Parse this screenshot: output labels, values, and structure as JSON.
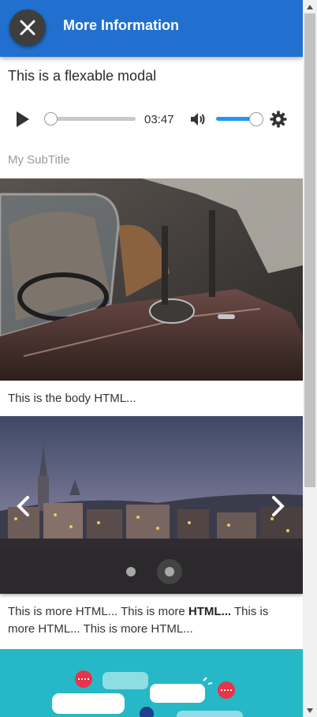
{
  "header": {
    "title": "More Information",
    "close_icon": "close-icon"
  },
  "modal": {
    "title": "This is a flexable modal",
    "subtitle": "My SubTitle",
    "body_text": "This is the body HTML...",
    "more_text": {
      "part1": "This is more HTML... This is more ",
      "bold": "HTML...",
      "part2": " This is more HTML... This is more HTML..."
    }
  },
  "player": {
    "time": "03:47",
    "progress": 0,
    "volume": 1.0,
    "icons": [
      "play-icon",
      "volume-icon",
      "gear-icon"
    ],
    "accent_color": "#2196f3"
  },
  "car_image": {
    "description_icon": "car-photo"
  },
  "carousel": {
    "slide_count": 2,
    "active_slide": 2,
    "icons": [
      "chevron-left-icon",
      "chevron-right-icon"
    ]
  },
  "colors": {
    "header_bg": "#2170cf",
    "illustration_bg": "#26b8c6"
  }
}
